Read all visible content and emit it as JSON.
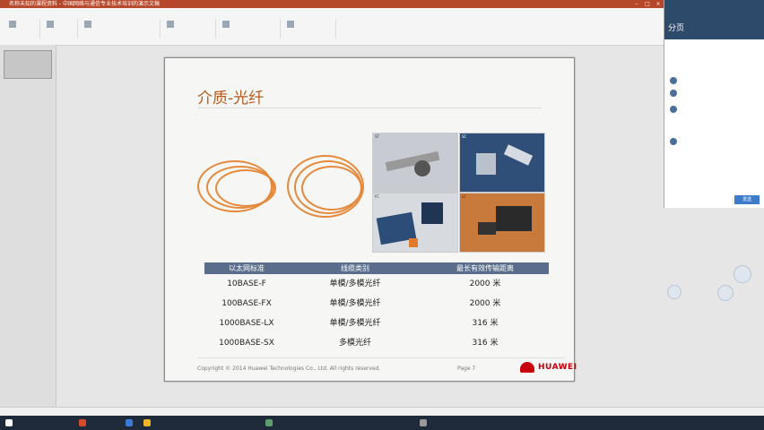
{
  "window": {
    "title": "名称未知的课程资料 - 中国网络与通信专业技术培训的演示文稿"
  },
  "slide": {
    "title": "介质-光纤",
    "photo_captions": [
      "ST",
      "SC",
      "FC",
      "LC"
    ],
    "table": {
      "headers": [
        "以太网标准",
        "线缆类别",
        "最长有效传输距离"
      ],
      "rows": [
        {
          "standard": "10BASE-F",
          "cable": "单模/多模光纤",
          "distance": "2000 米"
        },
        {
          "standard": "100BASE-FX",
          "cable": "单模/多模光纤",
          "distance": "2000 米"
        },
        {
          "standard": "1000BASE-LX",
          "cable": "单模/多模光纤",
          "distance": "316 米"
        },
        {
          "standard": "1000BASE-SX",
          "cable": "多模光纤",
          "distance": "316 米"
        }
      ]
    },
    "footer": {
      "copyright": "Copyright © 2014 Huawei Technologies Co., Ltd. All rights reserved.",
      "page": "Page 7",
      "logo_text": "HUAWEI"
    }
  },
  "side_panel": {
    "header_text": "分页",
    "button_label": "发送"
  },
  "colors": {
    "title_bar": "#b7472a",
    "slide_title": "#b85a1c",
    "table_header": "#5a6e8c",
    "huawei_red": "#c7000b",
    "taskbar": "#1f2b3a"
  }
}
